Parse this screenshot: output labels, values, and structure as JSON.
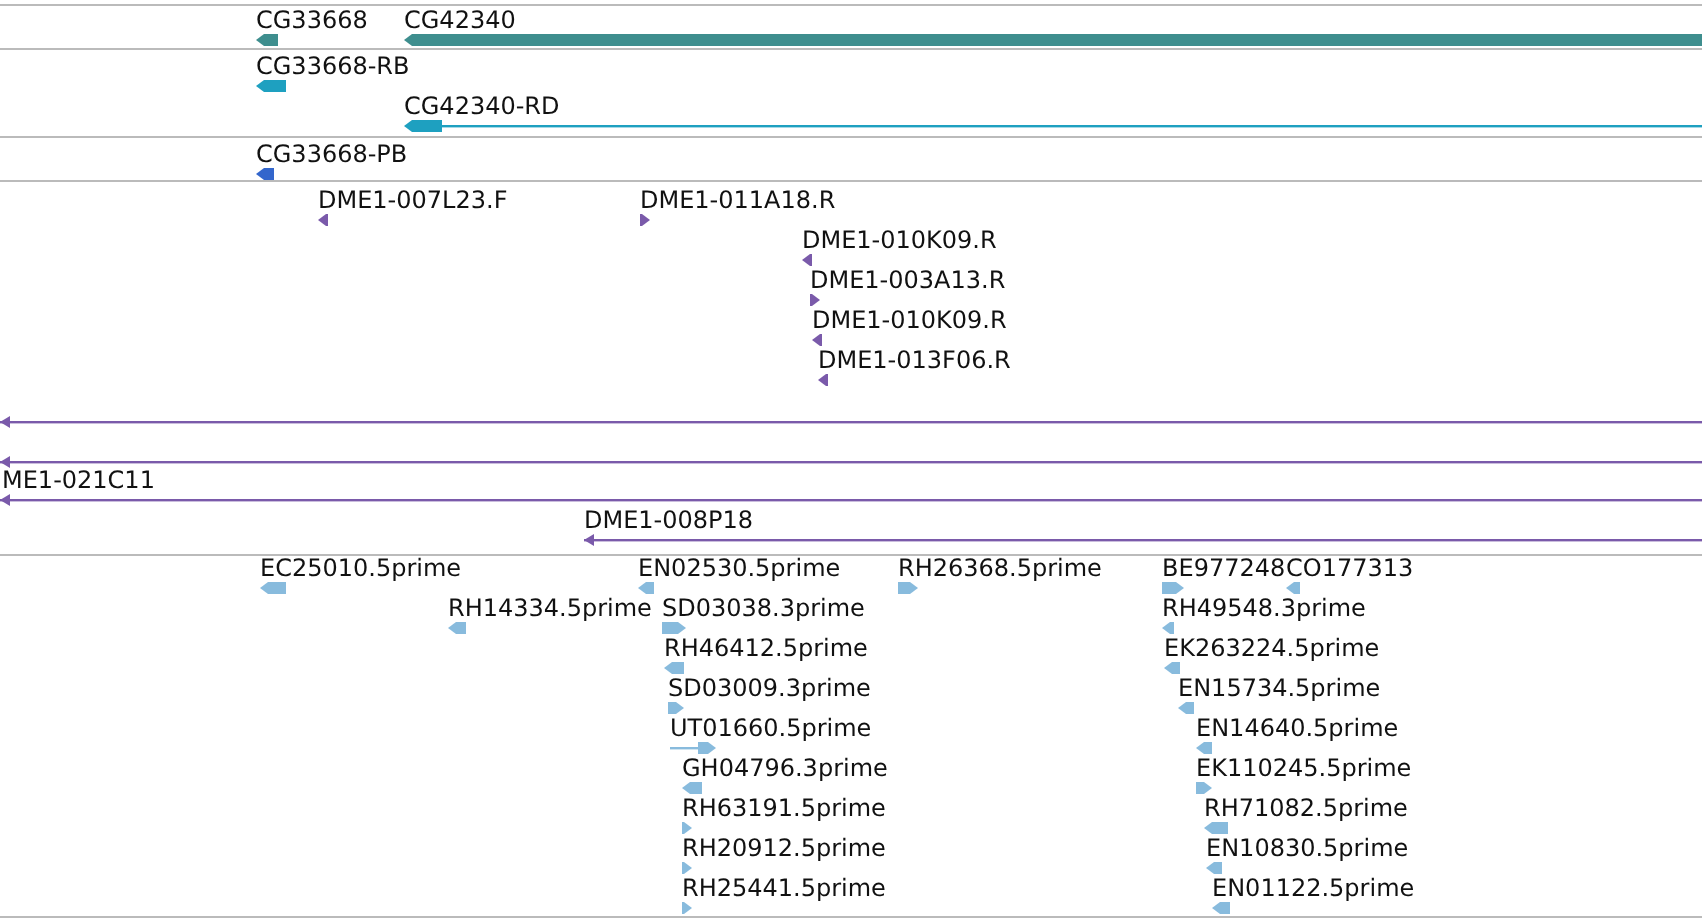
{
  "tracks": [
    {
      "kind": "gene",
      "features": [
        {
          "label": "CG33668",
          "reverse": true,
          "kind": "block"
        },
        {
          "label": "CG42340",
          "reverse": true,
          "kind": "block"
        }
      ]
    },
    {
      "kind": "transcript",
      "features": [
        {
          "label": "CG33668-RB",
          "reverse": true,
          "kind": "block"
        },
        {
          "label": "CG42340-RD",
          "reverse": true,
          "kind": "block_line"
        }
      ]
    },
    {
      "kind": "protein",
      "features": [
        {
          "label": "CG33668-PB",
          "reverse": true,
          "kind": "block"
        }
      ]
    },
    {
      "kind": "clone",
      "features": [
        {
          "label": "DME1-007L23.F",
          "reverse": true,
          "kind": "block"
        },
        {
          "label": "DME1-011A18.R",
          "reverse": false,
          "kind": "block"
        },
        {
          "label": "DME1-010K09.R",
          "reverse": true,
          "kind": "block"
        },
        {
          "label": "DME1-003A13.R",
          "reverse": false,
          "kind": "block"
        },
        {
          "label": "DME1-010K09.R",
          "reverse": true,
          "kind": "block"
        },
        {
          "label": "DME1-013F06.R",
          "reverse": true,
          "kind": "block"
        },
        {
          "reverse": true,
          "kind": "line"
        },
        {
          "reverse": true,
          "kind": "line"
        },
        {
          "label": "ME1-021C11",
          "reverse": true,
          "kind": "line"
        },
        {
          "label": "DME1-008P18",
          "reverse": true,
          "kind": "line"
        }
      ]
    },
    {
      "kind": "est",
      "features": [
        {
          "label": "EC25010.5prime",
          "reverse": true,
          "kind": "block"
        },
        {
          "label": "EN02530.5prime",
          "reverse": true,
          "kind": "block"
        },
        {
          "label": "RH26368.5prime",
          "reverse": false,
          "kind": "block"
        },
        {
          "label": "BE977248",
          "reverse": false,
          "kind": "block"
        },
        {
          "label": "CO177313",
          "reverse": true,
          "kind": "block"
        },
        {
          "label": "RH14334.5prime",
          "reverse": true,
          "kind": "block"
        },
        {
          "label": "SD03038.3prime",
          "reverse": false,
          "kind": "block"
        },
        {
          "label": "RH49548.3prime",
          "reverse": true,
          "kind": "block"
        },
        {
          "label": "RH46412.5prime",
          "reverse": true,
          "kind": "block"
        },
        {
          "label": "EK263224.5prime",
          "reverse": true,
          "kind": "block"
        },
        {
          "label": "SD03009.3prime",
          "reverse": false,
          "kind": "block"
        },
        {
          "label": "EN15734.5prime",
          "reverse": true,
          "kind": "block"
        },
        {
          "label": "UT01660.5prime",
          "reverse": false,
          "kind": "block_line"
        },
        {
          "label": "EN14640.5prime",
          "reverse": true,
          "kind": "block"
        },
        {
          "label": "GH04796.3prime",
          "reverse": true,
          "kind": "block"
        },
        {
          "label": "EK110245.5prime",
          "reverse": false,
          "kind": "block"
        },
        {
          "label": "RH63191.5prime",
          "reverse": false,
          "kind": "block"
        },
        {
          "label": "RH71082.5prime",
          "reverse": true,
          "kind": "block"
        },
        {
          "label": "RH20912.5prime",
          "reverse": false,
          "kind": "block"
        },
        {
          "label": "EN10830.5prime",
          "reverse": true,
          "kind": "block"
        },
        {
          "label": "RH25441.5prime",
          "reverse": false,
          "kind": "block"
        },
        {
          "label": "EN01122.5prime",
          "reverse": true,
          "kind": "block"
        }
      ]
    }
  ]
}
